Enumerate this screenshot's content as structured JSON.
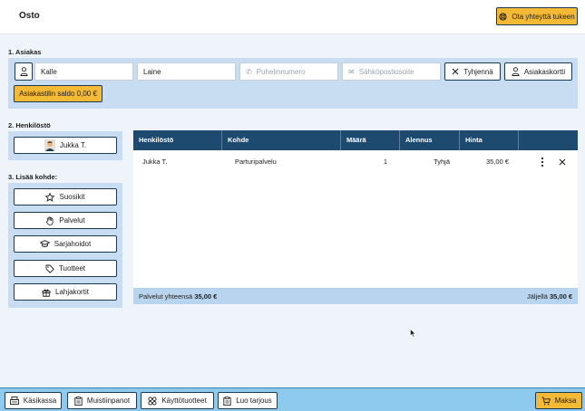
{
  "header": {
    "title": "Osto",
    "support_label": "Ota yhteyttä tukeen"
  },
  "customer": {
    "section_label": "1. Asiakas",
    "first_name": "Kalle",
    "last_name": "Laine",
    "phone_placeholder": "Puhelinnumero",
    "email_placeholder": "Sähköpostiosoite",
    "clear_label": "Tyhjennä",
    "card_label": "Asiakaskortti",
    "balance_label": "Asiakastilin saldo 0,00 €"
  },
  "staff": {
    "section_label": "2. Henkilöstö",
    "selected": "Jukka T."
  },
  "add_item": {
    "section_label": "3. Lisää kohde:",
    "buttons": [
      "Suosikit",
      "Palvelut",
      "Sarjahoidot",
      "Tuotteet",
      "Lahjakortit"
    ]
  },
  "table": {
    "headers": [
      "Henkilöstö",
      "Kohde",
      "Määrä",
      "Alennus",
      "Hinta",
      ""
    ],
    "rows": [
      {
        "staff": "Jukka T.",
        "item": "Parturipalvelu",
        "qty": "1",
        "discount": "Tyhjä",
        "price": "35,00 €"
      }
    ],
    "footer_left_label": "Palvelut yhteensä",
    "footer_left_value": "35,00 €",
    "footer_right_label": "Jäljellä",
    "footer_right_value": "35,00 €"
  },
  "bottom": {
    "cash_label": "Käsikassa",
    "notes_label": "Muistiinpanot",
    "supplies_label": "Käyttötuotteet",
    "offer_label": "Luo tarjous",
    "pay_label": "Maksa"
  },
  "colors": {
    "accent_yellow": "#f4b935",
    "table_header": "#1f4a70",
    "panel": "#c9ddf2",
    "bottom_bar": "#8ec9ee"
  }
}
